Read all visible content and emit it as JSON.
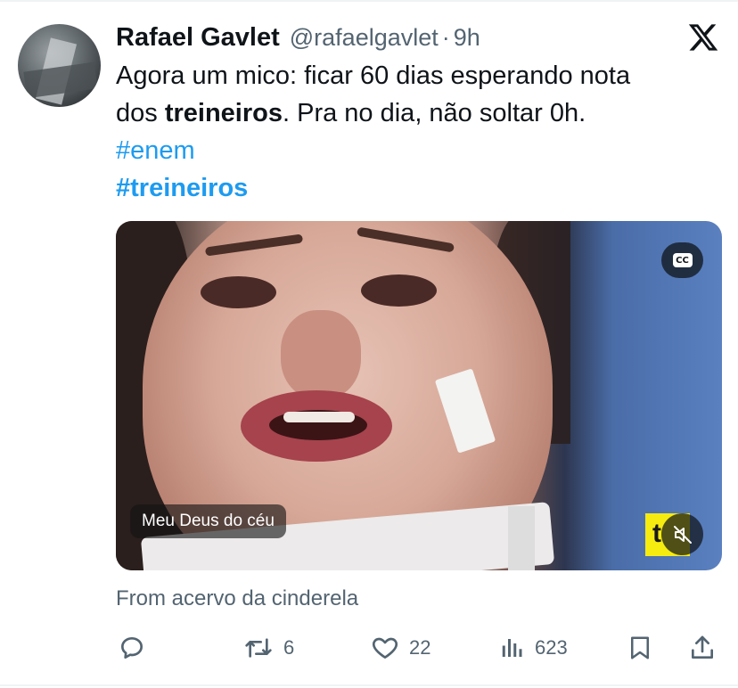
{
  "tweet": {
    "author": {
      "display_name": "Rafael Gavlet",
      "handle": "@rafaelgavlet",
      "separator": "·",
      "time": "9h"
    },
    "text": {
      "line1": "Agora um mico: ficar 60 dias esperando nota",
      "line2_before": "dos ",
      "line2_bold": "treineiros",
      "line2_after": ". Pra no dia, não soltar 0h."
    },
    "hashtags": [
      "#enem",
      "#treineiros"
    ],
    "media": {
      "caption": "Meu Deus do céu",
      "cc_label": "CC",
      "watermark_letter": "t"
    },
    "from_label": "From acervo da cinderela",
    "actions": {
      "reply_count": "",
      "retweet_count": "6",
      "like_count": "22",
      "views_count": "623"
    }
  },
  "icons": {
    "platform": "x-logo-icon",
    "reply": "reply-icon",
    "retweet": "retweet-icon",
    "like": "heart-icon",
    "views": "views-icon",
    "bookmark": "bookmark-icon",
    "share": "share-icon",
    "captions": "closed-captions-icon",
    "mute": "muted-speaker-icon"
  },
  "colors": {
    "text": "#0f1419",
    "secondary": "#536471",
    "link": "#1d9bf0",
    "watermark": "#f6ec10"
  }
}
